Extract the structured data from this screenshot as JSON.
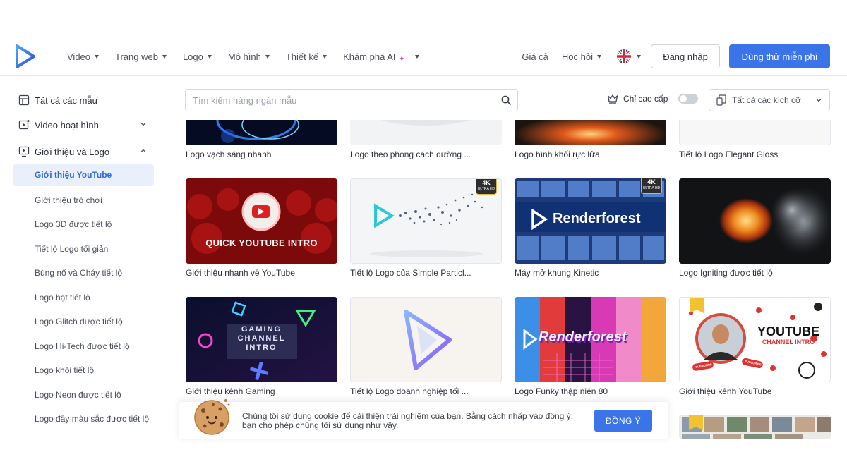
{
  "header": {
    "logo_icon": "play-logo-icon",
    "nav": [
      {
        "label": "Video",
        "has_caret": true
      },
      {
        "label": "Trang web",
        "has_caret": true
      },
      {
        "label": "Logo",
        "has_caret": true
      },
      {
        "label": "Mô hình",
        "has_caret": true
      },
      {
        "label": "Thiết kế",
        "has_caret": true
      },
      {
        "label": "Khám phá AI",
        "has_caret": true
      }
    ],
    "pricing": "Giá cả",
    "learn": "Học hỏi",
    "language_icon": "uk-flag-icon",
    "login": "Đăng nhập",
    "trial": "Dùng thử miễn phí"
  },
  "sidebar": {
    "all_templates": "Tất cả các mẫu",
    "animated_video": "Video hoạt hình",
    "intro_logo": "Giới thiệu và Logo",
    "active_item": "Giới thiệu YouTube",
    "items": [
      "Giới thiệu trò chơi",
      "Logo 3D được tiết lộ",
      "Tiết lộ Logo tối giản",
      "Bùng nổ và Cháy tiết lộ",
      "Logo hạt tiết lộ",
      "Logo Glitch được tiết lộ",
      "Logo Hi-Tech được tiết lộ",
      "Logo khói tiết lộ",
      "Logo Neon được tiết lộ",
      "Logo đầy màu sắc được tiết lộ"
    ]
  },
  "toolbar": {
    "search_placeholder": "Tìm kiếm hàng ngàn mẫu",
    "premium_only": "Chỉ cao cấp",
    "premium_toggle_on": false,
    "size_select": "Tất cả các kích cỡ"
  },
  "cards": [
    {
      "title": "Logo vạch sáng nhanh"
    },
    {
      "title": "Logo theo phong cách đường ..."
    },
    {
      "title": "Logo hình khối rực lửa"
    },
    {
      "title": "Tiết lộ Logo Elegant Gloss"
    },
    {
      "title": "Giới thiệu nhanh về YouTube",
      "thumb_text": "QUICK YOUTUBE INTRO"
    },
    {
      "title": "Tiết lộ Logo của Simple Particl...",
      "badge": "4K",
      "badge_sub": "ULTRA HD"
    },
    {
      "title": "Máy mở khung Kinetic",
      "badge": "4K",
      "badge_sub": "ULTRA HD",
      "thumb_text": "Renderforest"
    },
    {
      "title": "Logo Igniting được tiết lộ"
    },
    {
      "title": "Giới thiệu kênh Gaming",
      "thumb_text_lines": [
        "GAMING",
        "CHANNEL",
        "INTRO"
      ]
    },
    {
      "title": "Tiết lộ Logo doanh nghiệp tối ..."
    },
    {
      "title": "Logo Funky thập niên 80",
      "thumb_text": "Renderforest"
    },
    {
      "title": "Giới thiệu kênh YouTube",
      "thumb_text_lines": [
        "YOUTUBE",
        "CHANNEL INTRO"
      ],
      "stickers": [
        "SUBSCRIBE",
        "SUBSCRIBE"
      ]
    }
  ],
  "cookie": {
    "text": "Chúng tôi sử dụng cookie để cải thiện trải nghiệm của bạn. Bằng cách nhấp vào đồng ý, bạn cho phép chúng tôi sử dụng như vậy.",
    "accept": "ĐỒNG Ý"
  },
  "colors": {
    "accent": "#3b73e8",
    "active_bg": "#e9f0fc",
    "active_text": "#2f6ae0"
  }
}
